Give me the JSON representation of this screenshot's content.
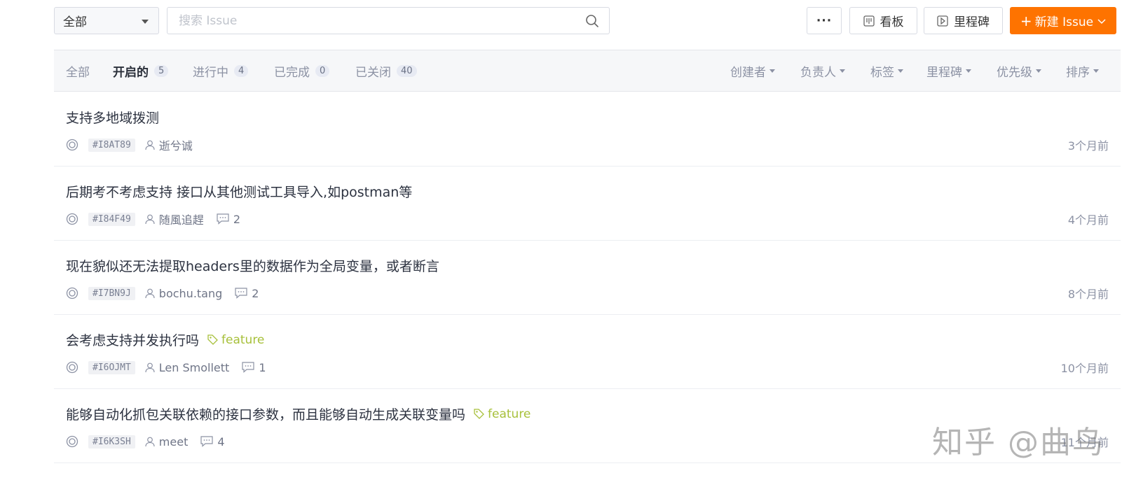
{
  "toolbar": {
    "scope_select": "全部",
    "search_placeholder": "搜索 Issue",
    "more_label": "···",
    "board_label": "看板",
    "milestone_label": "里程碑",
    "new_issue_label": "新建 Issue",
    "accent_color": "#fe7300"
  },
  "filters": {
    "tabs": [
      {
        "label": "全部",
        "count": ""
      },
      {
        "label": "开启的",
        "count": "5"
      },
      {
        "label": "进行中",
        "count": "4"
      },
      {
        "label": "已完成",
        "count": "0"
      },
      {
        "label": "已关闭",
        "count": "40"
      }
    ],
    "dropdowns": [
      "创建者",
      "负责人",
      "标签",
      "里程碑",
      "优先级",
      "排序"
    ]
  },
  "issues": [
    {
      "title": "支持多地域拨测",
      "id": "#I8AT89",
      "author": "逝兮诚",
      "comments": "",
      "label": "",
      "time": "3个月前"
    },
    {
      "title": "后期考不考虑支持 接口从其他测试工具导入,如postman等",
      "id": "#I84F49",
      "author": "随風追趕",
      "comments": "2",
      "label": "",
      "time": "4个月前"
    },
    {
      "title": "现在貌似还无法提取headers里的数据作为全局变量，或者断言",
      "id": "#I7BN9J",
      "author": "bochu.tang",
      "comments": "2",
      "label": "",
      "time": "8个月前"
    },
    {
      "title": "会考虑支持并发执行吗",
      "id": "#I6OJMT",
      "author": "Len Smollett",
      "comments": "1",
      "label": "feature",
      "time": "10个月前"
    },
    {
      "title": "能够自动化抓包关联依赖的接口参数，而且能够自动生成关联变量吗",
      "id": "#I6K3SH",
      "author": "meet",
      "comments": "4",
      "label": "feature",
      "time": "11个月前"
    }
  ],
  "watermark": "知乎 @曲鸟",
  "colors": {
    "label_feature": "#a7c03a",
    "tab_active": "#2a2f3a",
    "muted": "#8c92a4"
  }
}
